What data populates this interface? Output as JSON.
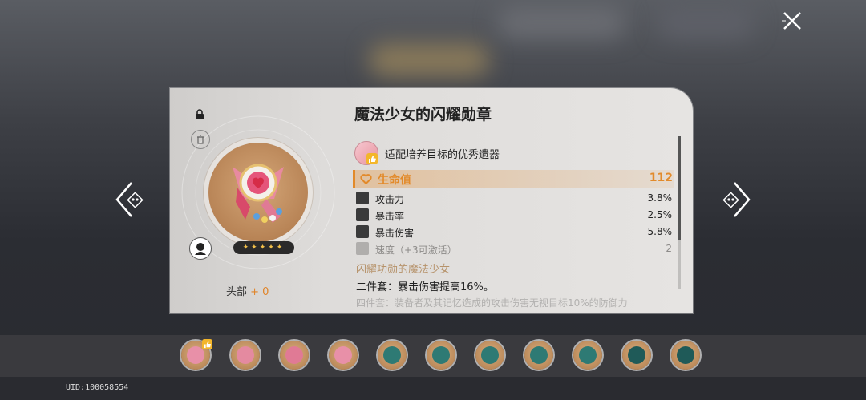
{
  "colors": {
    "accent": "#e28a2a",
    "stat_highlight": "#e28a2a",
    "set_name": "#b6926a",
    "stars": "#f3c04a"
  },
  "icons": {
    "close": "close-icon",
    "prev": "chevron-left-icon",
    "next": "chevron-right-icon",
    "lock": "lock-icon",
    "trash": "trash-icon",
    "character": "character-avatar-icon"
  },
  "item": {
    "title": "魔法少女的闪耀勋章",
    "recommend": "适配培养目标的优秀遗器",
    "rarity_stars": "✦✦✦✦✦",
    "slot": "头部",
    "level": "+ 0"
  },
  "main_stat": {
    "label": "生命值",
    "value": "112"
  },
  "sub_stats": [
    {
      "label": "攻击力",
      "value": "3.8%"
    },
    {
      "label": "暴击率",
      "value": "2.5%"
    },
    {
      "label": "暴击伤害",
      "value": "5.8%"
    },
    {
      "label": "速度（+3可激活）",
      "value": "2"
    }
  ],
  "set": {
    "name": "闪耀功勋的魔法少女",
    "two_piece": "二件套：暴击伤害提高16%。",
    "four_piece": "四件套：装备者及其记忆造成的攻击伤害无视目标10%的防御力"
  },
  "uid": "UID:100058554"
}
